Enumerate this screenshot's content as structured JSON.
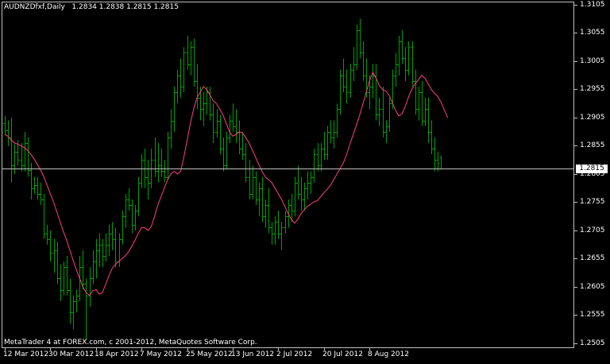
{
  "header": {
    "symbol": "AUDNZDfxf,Daily",
    "ohlc": "1.2834 1.2838 1.2815 1.2815"
  },
  "footer": {
    "copyright": "MetaTrader 4 at FOREX.com, c 2001-2012, MetaQuotes Software Corp."
  },
  "colors": {
    "background": "#000000",
    "bars": "#00a000",
    "moving_average": "#ff3f7f",
    "axis": "#bfbfbf",
    "text": "#ffffff"
  },
  "bid": {
    "label": "1.2815",
    "value": 1.2815
  },
  "price_axis": {
    "labels": [
      "1.3105",
      "1.3055",
      "1.3005",
      "1.2955",
      "1.2905",
      "1.2855",
      "1.2805",
      "1.2755",
      "1.2705",
      "1.2655",
      "1.2605",
      "1.2555",
      "1.2505"
    ]
  },
  "date_axis": {
    "labels": [
      "12 Mar 2012",
      "30 Mar 2012",
      "18 Apr 2012",
      "7 May 2012",
      "25 May 2012",
      "13 Jun 2012",
      "2 Jul 2012",
      "20 Jul 2012",
      "8 Aug 2012"
    ],
    "label_bar_index": [
      0,
      14,
      28,
      42,
      56,
      70,
      84,
      98,
      112
    ]
  },
  "chart_data": {
    "type": "ohlc-bar",
    "symbol": "AUDNZDfxf",
    "timeframe": "Daily",
    "ylim": [
      1.2505,
      1.3105
    ],
    "bars": [
      [
        1.2895,
        1.2908,
        1.2875,
        1.2882
      ],
      [
        1.2882,
        1.29,
        1.2855,
        1.287
      ],
      [
        1.287,
        1.2905,
        1.279,
        1.282
      ],
      [
        1.282,
        1.2858,
        1.2805,
        1.2845
      ],
      [
        1.2845,
        1.2865,
        1.282,
        1.283
      ],
      [
        1.283,
        1.286,
        1.281,
        1.282
      ],
      [
        1.282,
        1.288,
        1.281,
        1.286
      ],
      [
        1.286,
        1.287,
        1.28,
        1.2812
      ],
      [
        1.2812,
        1.2825,
        1.276,
        1.278
      ],
      [
        1.278,
        1.28,
        1.277,
        1.2785
      ],
      [
        1.2785,
        1.28,
        1.276,
        1.277
      ],
      [
        1.277,
        1.279,
        1.275,
        1.276
      ],
      [
        1.276,
        1.277,
        1.269,
        1.27
      ],
      [
        1.27,
        1.2715,
        1.268,
        1.269
      ],
      [
        1.269,
        1.2705,
        1.265,
        1.2665
      ],
      [
        1.2665,
        1.269,
        1.263,
        1.267
      ],
      [
        1.267,
        1.2685,
        1.261,
        1.262
      ],
      [
        1.262,
        1.2645,
        1.258,
        1.26
      ],
      [
        1.26,
        1.265,
        1.259,
        1.264
      ],
      [
        1.264,
        1.266,
        1.259,
        1.26
      ],
      [
        1.26,
        1.262,
        1.254,
        1.256
      ],
      [
        1.256,
        1.259,
        1.253,
        1.258
      ],
      [
        1.258,
        1.26,
        1.256,
        1.259
      ],
      [
        1.259,
        1.266,
        1.258,
        1.264
      ],
      [
        1.264,
        1.267,
        1.26,
        1.261
      ],
      [
        1.261,
        1.262,
        1.251,
        1.259
      ],
      [
        1.259,
        1.264,
        1.257,
        1.262
      ],
      [
        1.262,
        1.267,
        1.261,
        1.265
      ],
      [
        1.265,
        1.269,
        1.262,
        1.267
      ],
      [
        1.267,
        1.27,
        1.264,
        1.268
      ],
      [
        1.268,
        1.269,
        1.264,
        1.266
      ],
      [
        1.266,
        1.27,
        1.265,
        1.268
      ],
      [
        1.268,
        1.2715,
        1.266,
        1.27
      ],
      [
        1.27,
        1.272,
        1.267,
        1.269
      ],
      [
        1.269,
        1.271,
        1.264,
        1.265
      ],
      [
        1.265,
        1.27,
        1.264,
        1.269
      ],
      [
        1.269,
        1.274,
        1.268,
        1.273
      ],
      [
        1.273,
        1.277,
        1.271,
        1.276
      ],
      [
        1.276,
        1.278,
        1.274,
        1.275
      ],
      [
        1.275,
        1.276,
        1.27,
        1.2715
      ],
      [
        1.2715,
        1.275,
        1.2705,
        1.274
      ],
      [
        1.274,
        1.28,
        1.273,
        1.279
      ],
      [
        1.279,
        1.284,
        1.278,
        1.283
      ],
      [
        1.283,
        1.285,
        1.278,
        1.28
      ],
      [
        1.28,
        1.283,
        1.276,
        1.279
      ],
      [
        1.279,
        1.285,
        1.278,
        1.283
      ],
      [
        1.283,
        1.287,
        1.28,
        1.281
      ],
      [
        1.281,
        1.286,
        1.279,
        1.282
      ],
      [
        1.282,
        1.285,
        1.28,
        1.281
      ],
      [
        1.281,
        1.283,
        1.279,
        1.28
      ],
      [
        1.28,
        1.288,
        1.2795,
        1.287
      ],
      [
        1.287,
        1.292,
        1.285,
        1.29
      ],
      [
        1.29,
        1.296,
        1.288,
        1.295
      ],
      [
        1.295,
        1.299,
        1.293,
        1.298
      ],
      [
        1.298,
        1.301,
        1.294,
        1.296
      ],
      [
        1.296,
        1.303,
        1.295,
        1.302
      ],
      [
        1.302,
        1.305,
        1.299,
        1.3
      ],
      [
        1.3,
        1.304,
        1.298,
        1.303
      ],
      [
        1.303,
        1.3045,
        1.296,
        1.297
      ],
      [
        1.297,
        1.3,
        1.292,
        1.294
      ],
      [
        1.294,
        1.296,
        1.29,
        1.292
      ],
      [
        1.292,
        1.295,
        1.289,
        1.293
      ],
      [
        1.293,
        1.296,
        1.291,
        1.295
      ],
      [
        1.295,
        1.296,
        1.29,
        1.291
      ],
      [
        1.291,
        1.293,
        1.286,
        1.288
      ],
      [
        1.288,
        1.292,
        1.287,
        1.29
      ],
      [
        1.29,
        1.291,
        1.284,
        1.285
      ],
      [
        1.285,
        1.287,
        1.281,
        1.282
      ],
      [
        1.282,
        1.288,
        1.2815,
        1.287
      ],
      [
        1.287,
        1.291,
        1.286,
        1.29
      ],
      [
        1.29,
        1.293,
        1.288,
        1.289
      ],
      [
        1.289,
        1.292,
        1.286,
        1.288
      ],
      [
        1.288,
        1.29,
        1.284,
        1.285
      ],
      [
        1.285,
        1.288,
        1.283,
        1.284
      ],
      [
        1.284,
        1.286,
        1.279,
        1.28
      ],
      [
        1.28,
        1.283,
        1.276,
        1.277
      ],
      [
        1.277,
        1.282,
        1.276,
        1.28
      ],
      [
        1.28,
        1.281,
        1.275,
        1.276
      ],
      [
        1.276,
        1.279,
        1.273,
        1.278
      ],
      [
        1.278,
        1.28,
        1.272,
        1.273
      ],
      [
        1.273,
        1.276,
        1.271,
        1.275
      ],
      [
        1.275,
        1.278,
        1.27,
        1.271
      ],
      [
        1.271,
        1.272,
        1.268,
        1.27
      ],
      [
        1.27,
        1.273,
        1.268,
        1.272
      ],
      [
        1.272,
        1.274,
        1.269,
        1.27
      ],
      [
        1.27,
        1.272,
        1.267,
        1.271
      ],
      [
        1.271,
        1.274,
        1.27,
        1.273
      ],
      [
        1.273,
        1.276,
        1.271,
        1.275
      ],
      [
        1.275,
        1.277,
        1.272,
        1.274
      ],
      [
        1.274,
        1.28,
        1.273,
        1.279
      ],
      [
        1.279,
        1.282,
        1.276,
        1.277
      ],
      [
        1.277,
        1.28,
        1.274,
        1.276
      ],
      [
        1.276,
        1.279,
        1.274,
        1.278
      ],
      [
        1.278,
        1.281,
        1.276,
        1.279
      ],
      [
        1.279,
        1.281,
        1.277,
        1.28
      ],
      [
        1.28,
        1.285,
        1.279,
        1.284
      ],
      [
        1.284,
        1.286,
        1.281,
        1.282
      ],
      [
        1.282,
        1.286,
        1.281,
        1.285
      ],
      [
        1.285,
        1.288,
        1.283,
        1.284
      ],
      [
        1.284,
        1.289,
        1.283,
        1.288
      ],
      [
        1.288,
        1.29,
        1.286,
        1.287
      ],
      [
        1.287,
        1.29,
        1.285,
        1.288
      ],
      [
        1.288,
        1.293,
        1.287,
        1.292
      ],
      [
        1.292,
        1.299,
        1.291,
        1.298
      ],
      [
        1.298,
        1.301,
        1.295,
        1.296
      ],
      [
        1.296,
        1.299,
        1.293,
        1.295
      ],
      [
        1.295,
        1.3,
        1.294,
        1.299
      ],
      [
        1.299,
        1.303,
        1.297,
        1.3
      ],
      [
        1.3,
        1.307,
        1.299,
        1.306
      ],
      [
        1.306,
        1.308,
        1.301,
        1.302
      ],
      [
        1.302,
        1.304,
        1.297,
        1.298
      ],
      [
        1.298,
        1.301,
        1.294,
        1.295
      ],
      [
        1.295,
        1.298,
        1.292,
        1.296
      ],
      [
        1.296,
        1.3,
        1.294,
        1.298
      ],
      [
        1.298,
        1.3,
        1.29,
        1.291
      ],
      [
        1.291,
        1.294,
        1.289,
        1.292
      ],
      [
        1.292,
        1.296,
        1.287,
        1.288
      ],
      [
        1.288,
        1.29,
        1.286,
        1.289
      ],
      [
        1.289,
        1.294,
        1.288,
        1.293
      ],
      [
        1.293,
        1.299,
        1.292,
        1.298
      ],
      [
        1.298,
        1.302,
        1.296,
        1.3
      ],
      [
        1.3,
        1.305,
        1.298,
        1.304
      ],
      [
        1.304,
        1.306,
        1.3,
        1.301
      ],
      [
        1.301,
        1.303,
        1.297,
        1.299
      ],
      [
        1.299,
        1.304,
        1.298,
        1.303
      ],
      [
        1.303,
        1.304,
        1.296,
        1.297
      ],
      [
        1.297,
        1.299,
        1.291,
        1.292
      ],
      [
        1.292,
        1.296,
        1.29,
        1.295
      ],
      [
        1.295,
        1.297,
        1.289,
        1.29
      ],
      [
        1.29,
        1.294,
        1.289,
        1.292
      ],
      [
        1.292,
        1.294,
        1.286,
        1.288
      ],
      [
        1.288,
        1.29,
        1.284,
        1.285
      ],
      [
        1.285,
        1.287,
        1.281,
        1.283
      ],
      [
        1.283,
        1.2845,
        1.281,
        1.2825
      ],
      [
        1.2834,
        1.2838,
        1.2815,
        1.2815
      ]
    ],
    "moving_average": [
      1.2875,
      1.2872,
      1.2865,
      1.286,
      1.2858,
      1.2855,
      1.2852,
      1.2847,
      1.284,
      1.2832,
      1.2822,
      1.2812,
      1.28,
      1.2785,
      1.277,
      1.2755,
      1.2738,
      1.272,
      1.2703,
      1.2688,
      1.267,
      1.2652,
      1.2635,
      1.262,
      1.2605,
      1.2595,
      1.259,
      1.2598,
      1.26,
      1.2592,
      1.2595,
      1.261,
      1.2625,
      1.2638,
      1.2645,
      1.265,
      1.2655,
      1.266,
      1.2667,
      1.2677,
      1.2688,
      1.27,
      1.271,
      1.271,
      1.2705,
      1.2712,
      1.273,
      1.275,
      1.2765,
      1.278,
      1.2795,
      1.2805,
      1.281,
      1.2805,
      1.281,
      1.2835,
      1.2865,
      1.2895,
      1.292,
      1.294,
      1.295,
      1.296,
      1.2955,
      1.2945,
      1.2935,
      1.293,
      1.292,
      1.291,
      1.2895,
      1.288,
      1.2872,
      1.2875,
      1.288,
      1.2878,
      1.287,
      1.286,
      1.2848,
      1.2835,
      1.2822,
      1.281,
      1.28,
      1.2795,
      1.279,
      1.278,
      1.277,
      1.276,
      1.2748,
      1.2735,
      1.2725,
      1.2718,
      1.2725,
      1.2735,
      1.2742,
      1.2748,
      1.2752,
      1.2756,
      1.2758,
      1.2765,
      1.2772,
      1.2778,
      1.2785,
      1.2795,
      1.2805,
      1.2815,
      1.2825,
      1.284,
      1.2858,
      1.2875,
      1.2892,
      1.291,
      1.293,
      1.295,
      1.297,
      1.2985,
      1.2975,
      1.2962,
      1.2955,
      1.2952,
      1.2945,
      1.2932,
      1.2918,
      1.2908,
      1.2912,
      1.2925,
      1.2942,
      1.2955,
      1.2965,
      1.2972,
      1.298,
      1.2975,
      1.2965,
      1.2955,
      1.2948,
      1.2942,
      1.2932,
      1.2918,
      1.2905
    ]
  }
}
